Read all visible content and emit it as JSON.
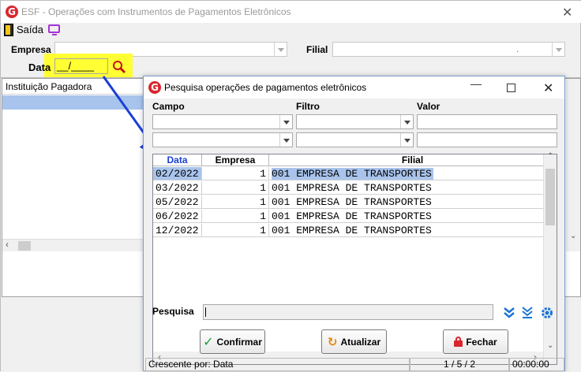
{
  "main": {
    "title": "ESF - Operações com Instrumentos de Pagamentos Eletrônicos",
    "toolbar": {
      "exit_label": "Saída"
    },
    "fields": {
      "empresa_label": "Empresa",
      "filial_label": "Filial",
      "data_label": "Data",
      "data_value": "__/____",
      "filial_value": "."
    },
    "list_header": "Instituição Pagadora"
  },
  "dialog": {
    "title": "Pesquisa operações de pagamentos eletrônicos",
    "filter_headers": {
      "campo": "Campo",
      "filtro": "Filtro",
      "valor": "Valor"
    },
    "grid": {
      "columns": [
        "Data",
        "Empresa",
        "Filial"
      ],
      "rows": [
        {
          "data": "02/2022",
          "empresa": "1",
          "filial": "001 EMPRESA DE TRANSPORTES"
        },
        {
          "data": "03/2022",
          "empresa": "1",
          "filial": "001 EMPRESA DE TRANSPORTES"
        },
        {
          "data": "05/2022",
          "empresa": "1",
          "filial": "001 EMPRESA DE TRANSPORTES"
        },
        {
          "data": "06/2022",
          "empresa": "1",
          "filial": "001 EMPRESA DE TRANSPORTES"
        },
        {
          "data": "12/2022",
          "empresa": "1",
          "filial": "001 EMPRESA DE TRANSPORTES"
        }
      ]
    },
    "search_label": "Pesquisa",
    "buttons": {
      "confirm": "Confirmar",
      "refresh": "Atualizar",
      "close": "Fechar"
    },
    "status": {
      "sort": "Crescente por: Data",
      "position": "1 / 5 / 2",
      "time": "00:00:00"
    }
  },
  "colors": {
    "accent": "#d9262e",
    "highlight": "#ffff33",
    "selection": "#a9c4ec",
    "arrow": "#1a3fd6",
    "icon_blue": "#1b74d6"
  }
}
